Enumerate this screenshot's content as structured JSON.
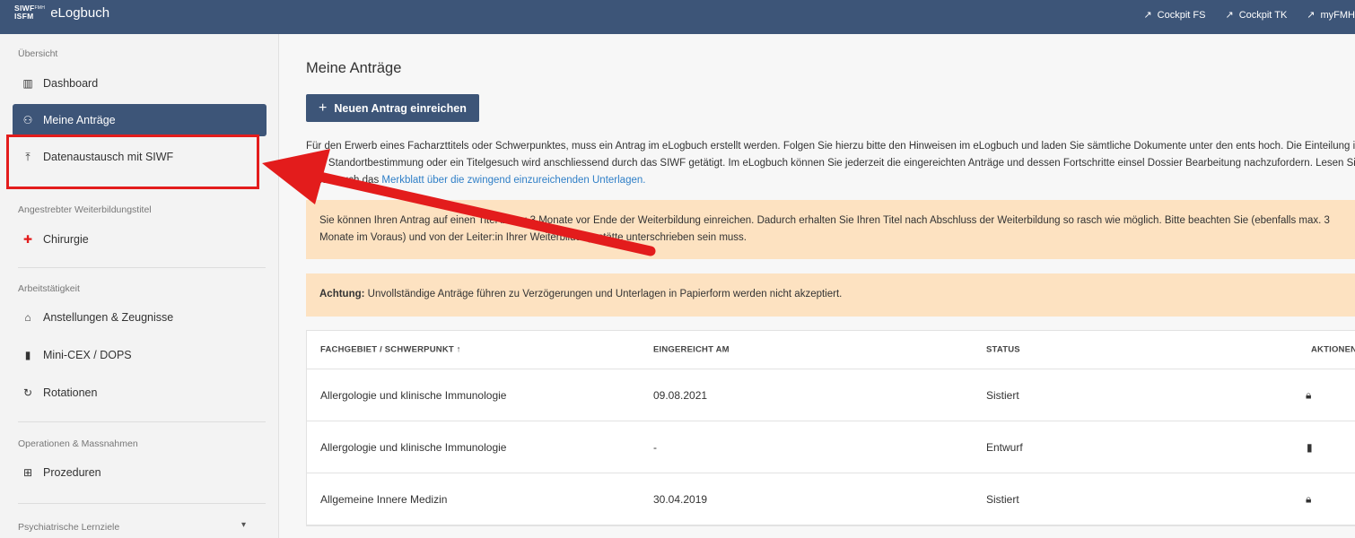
{
  "header": {
    "logo_line1": "SIWF",
    "logo_fmh": "FMH",
    "logo_line2": "ISFM",
    "app_name": "eLogbuch",
    "links": [
      {
        "label": "Cockpit FS",
        "icon": "external-arrow-icon"
      },
      {
        "label": "Cockpit TK",
        "icon": "external-arrow-icon"
      },
      {
        "label": "myFMH",
        "icon": "external-arrow-icon"
      }
    ]
  },
  "sidebar": {
    "section_overview": "Übersicht",
    "dashboard": "Dashboard",
    "meine_antraege": "Meine Anträge",
    "datenaustausch": "Datenaustausch mit SIWF",
    "section_title": "Angestrebter Weiterbildungstitel",
    "chirurgie": "Chirurgie",
    "section_work": "Arbeitstätigkeit",
    "anstellungen": "Anstellungen & Zeugnisse",
    "minicex": "Mini-CEX / DOPS",
    "rotationen": "Rotationen",
    "section_ops": "Operationen & Massnahmen",
    "prozeduren": "Prozeduren",
    "section_psych": "Psychiatrische Lernziele"
  },
  "main": {
    "title": "Meine Anträge",
    "new_button": "Neuen Antrag einreichen",
    "intro_text": "Für den Erwerb eines Facharzttitels oder Schwerpunktes, muss ein Antrag im eLogbuch erstellt werden. Folgen Sie hierzu bitte den Hinweisen im eLogbuch und laden Sie sämtliche Dokumente unter den ents hoch. Die Einteilung in eine Standortbestimmung oder ein Titelgesuch wird anschliessend durch das SIWF getätigt. Im eLogbuch können Sie jederzeit die eingereichten Anträge und dessen Fortschritte einsel Dossier Bearbeitung nachzufordern. Lesen Sie hierzu auch das ",
    "intro_link": "Merkblatt über die zwingend einzureichenden Unterlagen.",
    "alert1": "Sie können Ihren Antrag auf einen Titel bis zu 3 Monate vor Ende der Weiterbildung einreichen. Dadurch erhalten Sie Ihren Titel nach Abschluss der Weiterbildung so rasch wie möglich. Bitte beachten Sie (ebenfalls max. 3 Monate im Voraus) und von der Leiter:in Ihrer Weiterbildungsstätte unterschrieben sein muss.",
    "alert2_bold": "Achtung:",
    "alert2_text": " Unvollständige Anträge führen zu Verzögerungen und Unterlagen in Papierform werden nicht akzeptiert."
  },
  "table": {
    "headers": [
      "FACHGEBIET / SCHWERPUNKT",
      "EINGEREICHT AM",
      "STATUS",
      "AKTIONEN"
    ],
    "sort_icon": "sort-arrow-up-icon",
    "rows": [
      {
        "fach": "Allergologie und klinische Immunologie",
        "datum": "09.08.2021",
        "status": "Sistiert",
        "action": "lock-icon"
      },
      {
        "fach": "Allergologie und klinische Immunologie",
        "datum": "-",
        "status": "Entwurf",
        "action": "trash-icon"
      },
      {
        "fach": "Allgemeine Innere Medizin",
        "datum": "30.04.2019",
        "status": "Sistiert",
        "action": "lock-icon"
      }
    ]
  },
  "colors": {
    "primary": "#3d5578",
    "alert_bg": "#fde2c1",
    "highlight": "#e31c1c",
    "link": "#2f7fc7"
  }
}
